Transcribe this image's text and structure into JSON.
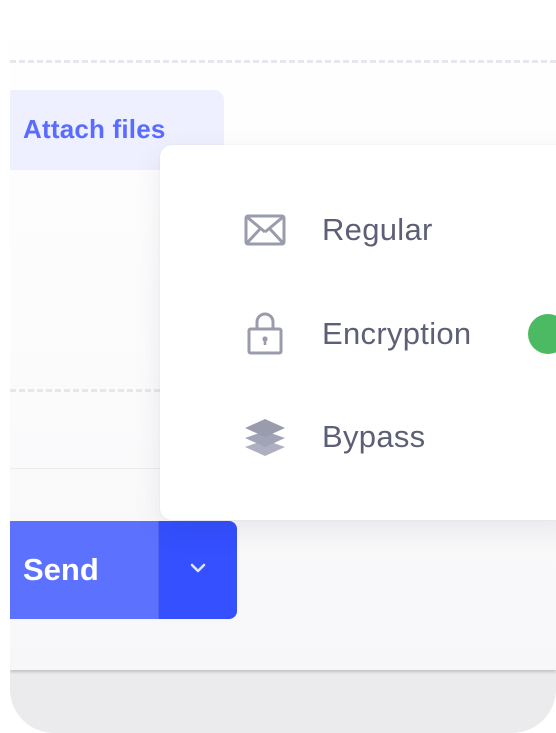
{
  "compose": {
    "attach_label": "Attach files",
    "send_label": "Send"
  },
  "send_menu": {
    "items": [
      {
        "label": "Regular",
        "icon": "envelope-icon"
      },
      {
        "label": "Encryption",
        "icon": "lock-icon",
        "toggle_on": true
      },
      {
        "label": "Bypass",
        "icon": "layers-icon"
      }
    ]
  },
  "colors": {
    "accent": "#5c72ff",
    "accent_dark": "#3450ff",
    "attach_bg": "#eef0ff",
    "attach_text": "#5a6bff",
    "menu_text": "#5c5f76",
    "icon": "#9a9cae",
    "toggle_on": "#4cb963"
  }
}
